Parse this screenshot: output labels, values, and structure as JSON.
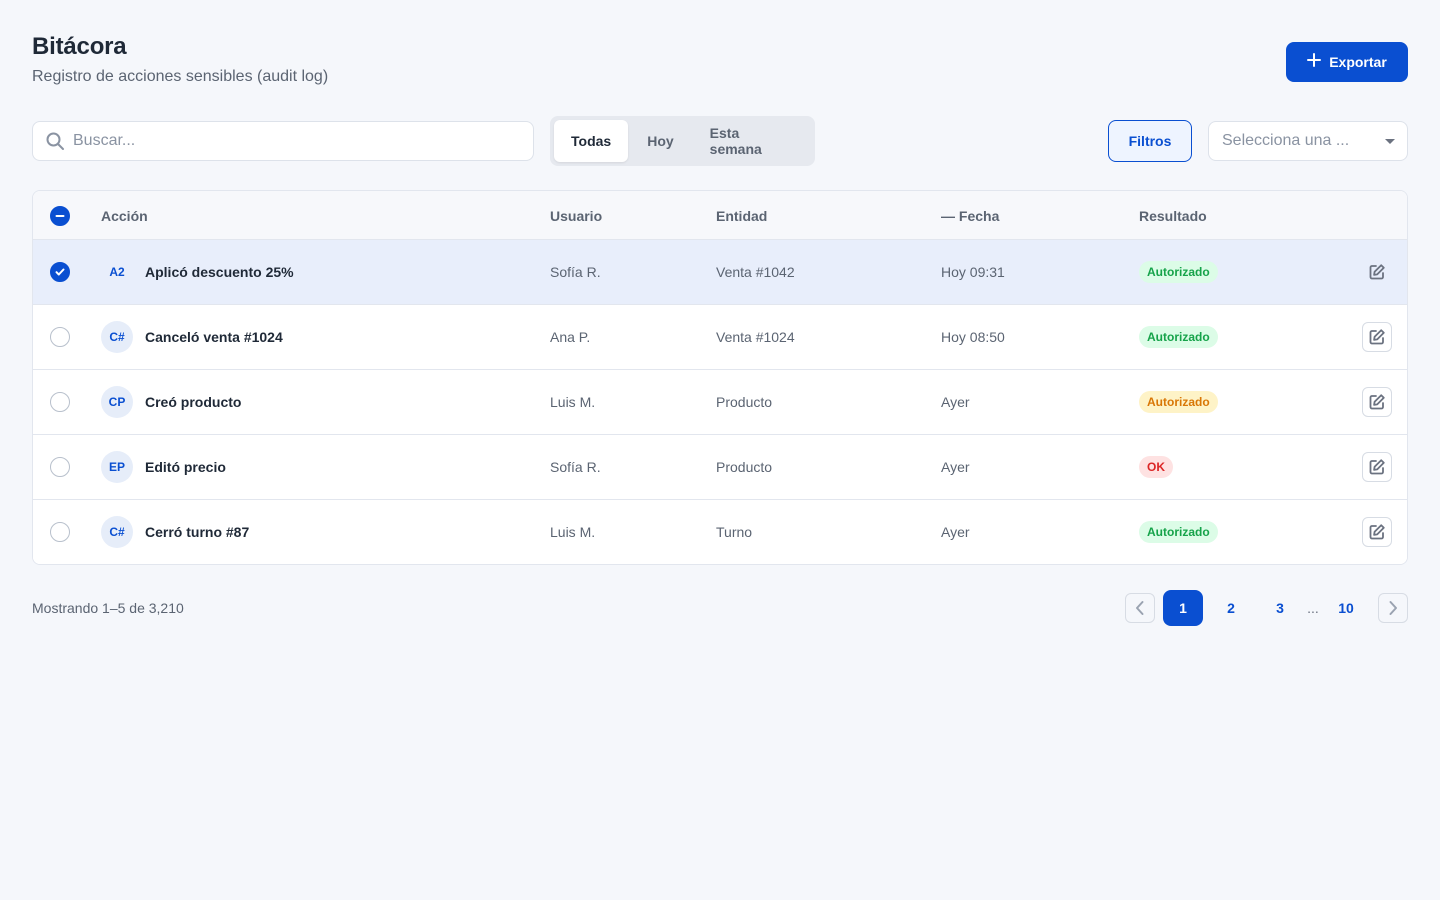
{
  "header": {
    "title": "Bitácora",
    "subtitle": "Registro de acciones sensibles (audit log)",
    "export_label": "Exportar"
  },
  "toolbar": {
    "search_placeholder": "Buscar...",
    "segments": [
      {
        "label": "Todas",
        "active": true
      },
      {
        "label": "Hoy",
        "active": false
      },
      {
        "label": "Esta semana",
        "active": false
      }
    ],
    "filters_label": "Filtros",
    "select_placeholder": "Selecciona una ..."
  },
  "table": {
    "columns": {
      "action": "Acción",
      "user": "Usuario",
      "entity": "Entidad",
      "date": "— Fecha",
      "result": "Resultado"
    },
    "rows": [
      {
        "initials": "A2",
        "action": "Aplicó descuento 25%",
        "user": "Sofía R.",
        "entity": "Venta #1042",
        "date": "Hoy 09:31",
        "result": "Autorizado",
        "result_color": "#16a34a",
        "result_bg": "#dcfce7",
        "selected": true
      },
      {
        "initials": "C#",
        "action": "Canceló venta #1024",
        "user": "Ana P.",
        "entity": "Venta #1024",
        "date": "Hoy 08:50",
        "result": "Autorizado",
        "result_color": "#16a34a",
        "result_bg": "#dcfce7",
        "selected": false
      },
      {
        "initials": "CP",
        "action": "Creó producto",
        "user": "Luis M.",
        "entity": "Producto",
        "date": "Ayer",
        "result": "Autorizado",
        "result_color": "#d97706",
        "result_bg": "#fef3c7",
        "selected": false
      },
      {
        "initials": "EP",
        "action": "Editó precio",
        "user": "Sofía R.",
        "entity": "Producto",
        "date": "Ayer",
        "result": "OK",
        "result_color": "#dc2626",
        "result_bg": "#fee2e2",
        "selected": false
      },
      {
        "initials": "C#",
        "action": "Cerró turno #87",
        "user": "Luis M.",
        "entity": "Turno",
        "date": "Ayer",
        "result": "Autorizado",
        "result_color": "#16a34a",
        "result_bg": "#dcfce7",
        "selected": false
      }
    ]
  },
  "footer": {
    "showing": "Mostrando 1–5 de 3,210",
    "pages": [
      "1",
      "2",
      "3",
      "10"
    ],
    "current_page": "1",
    "ellipsis": "..."
  },
  "colors": {
    "accent": "#0a4fd1",
    "background": "#f5f7fb",
    "selected_row": "#e8eefb"
  }
}
